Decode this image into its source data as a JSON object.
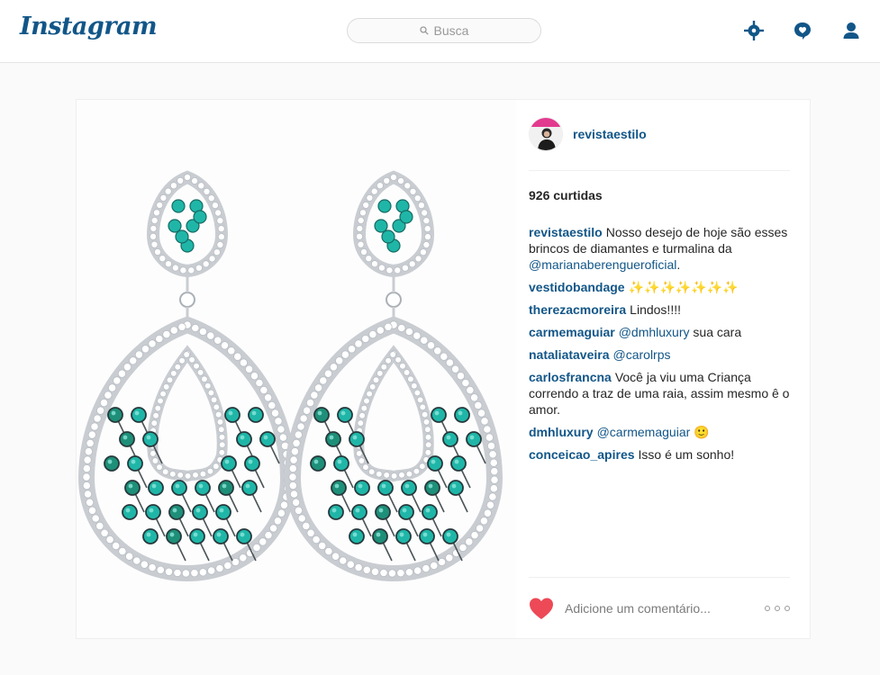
{
  "header": {
    "logo": "Instagram",
    "search_placeholder": "Busca",
    "icons": [
      "explore-icon",
      "activity-icon",
      "profile-icon"
    ]
  },
  "post": {
    "owner": "revistaestilo",
    "likes": "926 curtidas",
    "comments": [
      {
        "user": "revistaestilo",
        "text": "Nosso desejo de hoje são esses brincos de diamantes e turmalina da",
        "mention": "@marianaberengueroficial",
        "suffix": "."
      },
      {
        "user": "vestidobandage",
        "text": "✨✨✨✨✨✨✨"
      },
      {
        "user": "therezacmoreira",
        "text": "Lindos!!!!"
      },
      {
        "user": "carmemaguiar",
        "mention": "@dmhluxury",
        "text": "sua cara"
      },
      {
        "user": "nataliataveira",
        "mention": "@carolrps",
        "text": ""
      },
      {
        "user": "carlosfrancna",
        "text": "Você ja viu uma Criança correndo a traz de uma raia, assim mesmo ê o amor."
      },
      {
        "user": "dmhluxury",
        "mention": "@carmemaguiar",
        "text": "🙂"
      },
      {
        "user": "conceicao_apires",
        "text": "Isso é um sonho!"
      }
    ],
    "add_comment_placeholder": "Adicione um comentário..."
  },
  "colors": {
    "brand": "#125688",
    "heart": "#ed4956",
    "gem": "#1fb6a8",
    "metal": "#c9cdd2"
  }
}
